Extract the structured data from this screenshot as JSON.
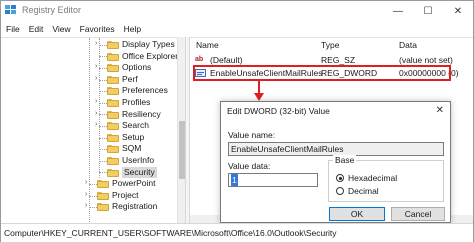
{
  "window": {
    "title": "Registry Editor",
    "controls": {
      "minimize": "—",
      "maximize": "☐",
      "close": "✕"
    }
  },
  "menu": [
    "File",
    "Edit",
    "View",
    "Favorites",
    "Help"
  ],
  "tree": {
    "items": [
      {
        "label": "Display Types",
        "expander": "›"
      },
      {
        "label": "Office Explorer",
        "expander": ""
      },
      {
        "label": "Options",
        "expander": "›"
      },
      {
        "label": "Perf",
        "expander": "›"
      },
      {
        "label": "Preferences",
        "expander": ""
      },
      {
        "label": "Profiles",
        "expander": "›"
      },
      {
        "label": "Resiliency",
        "expander": "›"
      },
      {
        "label": "Search",
        "expander": "›"
      },
      {
        "label": "Setup",
        "expander": ""
      },
      {
        "label": "SQM",
        "expander": ""
      },
      {
        "label": "UserInfo",
        "expander": ""
      },
      {
        "label": "Security",
        "expander": "",
        "selected": true
      },
      {
        "label": "PowerPoint",
        "expander": "›"
      },
      {
        "label": "Project",
        "expander": "›"
      },
      {
        "label": "Registration",
        "expander": "›"
      }
    ]
  },
  "list": {
    "columns": {
      "name": "Name",
      "type": "Type",
      "data": "Data"
    },
    "rows": [
      {
        "name": "(Default)",
        "type": "REG_SZ",
        "data": "(value not set)",
        "icon": "string-value-icon"
      },
      {
        "name": "EnableUnsafeClientMailRules",
        "type": "REG_DWORD",
        "data": "0x00000000 (0)",
        "icon": "dword-value-icon"
      }
    ]
  },
  "annotation": {
    "highlight_color": "#e02020"
  },
  "dialog": {
    "title": "Edit DWORD (32-bit) Value",
    "close": "✕",
    "value_name_label": "Value name:",
    "value_name": "EnableUnsafeClientMailRules",
    "value_data_label": "Value data:",
    "value_data": "1",
    "base_label": "Base",
    "base_options": [
      "Hexadecimal",
      "Decimal"
    ],
    "base_selected": "Hexadecimal",
    "ok": "OK",
    "cancel": "Cancel"
  },
  "statusbar": {
    "path": "Computer\\HKEY_CURRENT_USER\\SOFTWARE\\Microsoft\\Office\\16.0\\Outlook\\Security"
  }
}
